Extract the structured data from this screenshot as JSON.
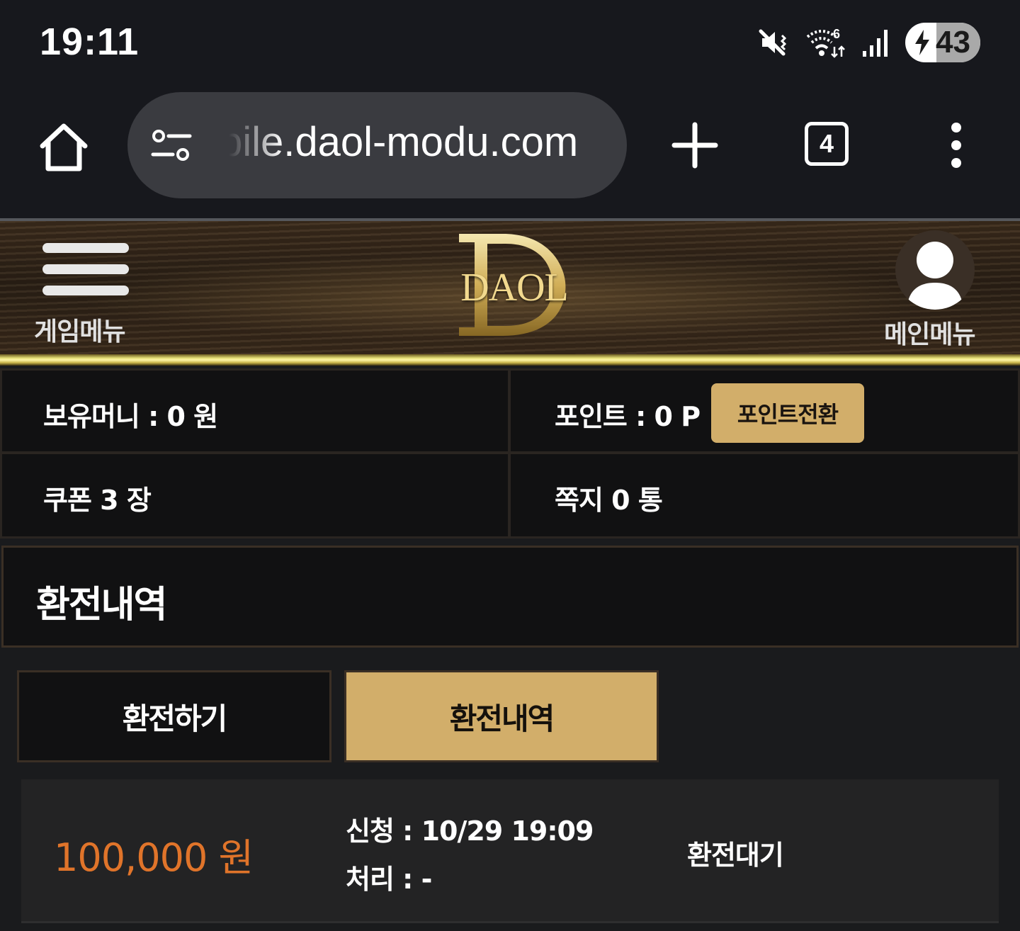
{
  "status_bar": {
    "time": "19:11",
    "icons": [
      "mute-vibrate-icon",
      "wifi-6-icon",
      "cell-signal-icon",
      "battery-charging-icon"
    ],
    "battery_level": "43"
  },
  "browser": {
    "url": "bile.daol-modu.com",
    "tab_count": "4",
    "icons": [
      "home-icon",
      "site-settings-icon",
      "new-tab-icon",
      "tab-switcher-icon",
      "more-menu-icon"
    ]
  },
  "header": {
    "left_menu_label": "게임메뉴",
    "logo_text": "DAOL",
    "right_menu_label": "메인메뉴",
    "accent_color": "#d2ae6a"
  },
  "info": {
    "money": "보유머니 : 0 원",
    "points": "포인트 : 0 P",
    "point_convert_label": "포인트전환",
    "coupons": "쿠폰 3 장",
    "messages": "쪽지 0 통"
  },
  "section": {
    "title": "환전내역"
  },
  "tabs": {
    "exchange_label": "환전하기",
    "history_label": "환전내역",
    "active": "환전내역"
  },
  "records": [
    {
      "amount": "100,000 원",
      "requested": "신청 : 10/29 19:09",
      "processed": "처리 : -",
      "status": "환전대기",
      "amount_color": "#e0742a"
    }
  ]
}
